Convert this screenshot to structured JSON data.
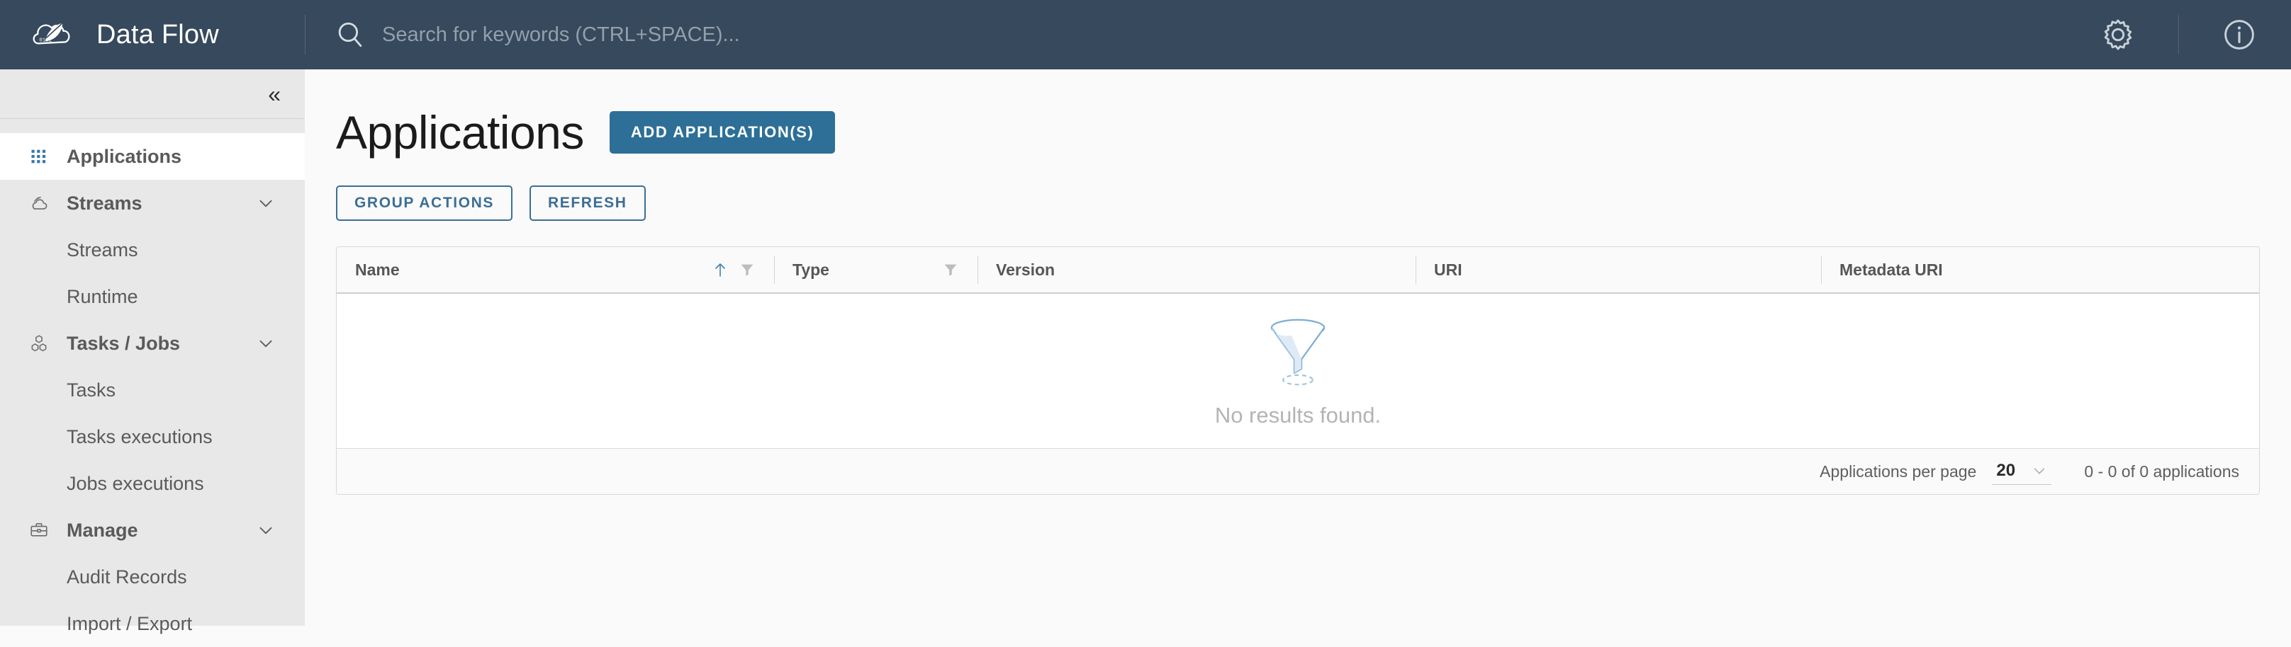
{
  "header": {
    "brand_title": "Data Flow",
    "logo_icon": "spring-cloud-dataflow-logo",
    "search": {
      "icon": "search-icon",
      "placeholder": "Search for keywords (CTRL+SPACE)...",
      "value": ""
    },
    "settings_icon": "gear-icon",
    "about_icon": "info-circle-icon"
  },
  "sidebar": {
    "collapse_icon": "double-chevron-left-icon",
    "items": [
      {
        "label": "Applications",
        "icon": "grid-dots-icon",
        "type": "link",
        "active": true,
        "expandable": false
      },
      {
        "label": "Streams",
        "icon": "cloud-icon",
        "type": "group",
        "active": false,
        "expandable": true
      },
      {
        "label": "Streams",
        "icon": "",
        "type": "sub",
        "active": false,
        "expandable": false
      },
      {
        "label": "Runtime",
        "icon": "",
        "type": "sub",
        "active": false,
        "expandable": false
      },
      {
        "label": "Tasks / Jobs",
        "icon": "boxes-icon",
        "type": "group",
        "active": false,
        "expandable": true
      },
      {
        "label": "Tasks",
        "icon": "",
        "type": "sub",
        "active": false,
        "expandable": false
      },
      {
        "label": "Tasks executions",
        "icon": "",
        "type": "sub",
        "active": false,
        "expandable": false
      },
      {
        "label": "Jobs executions",
        "icon": "",
        "type": "sub",
        "active": false,
        "expandable": false
      },
      {
        "label": "Manage",
        "icon": "briefcase-icon",
        "type": "group",
        "active": false,
        "expandable": true
      },
      {
        "label": "Audit Records",
        "icon": "",
        "type": "sub",
        "active": false,
        "expandable": false
      },
      {
        "label": "Import / Export",
        "icon": "",
        "type": "sub",
        "active": false,
        "expandable": false
      }
    ]
  },
  "main": {
    "title": "Applications",
    "add_button": "ADD APPLICATION(S)",
    "group_actions_button": "GROUP ACTIONS",
    "refresh_button": "REFRESH",
    "table": {
      "columns": [
        {
          "label": "Name",
          "sortable": true,
          "sort": "asc",
          "filter": true
        },
        {
          "label": "Type",
          "sortable": false,
          "sort": "none",
          "filter": true
        },
        {
          "label": "Version",
          "sortable": false,
          "sort": "none",
          "filter": false
        },
        {
          "label": "URI",
          "sortable": false,
          "sort": "none",
          "filter": false
        },
        {
          "label": "Metadata URI",
          "sortable": false,
          "sort": "none",
          "filter": false
        }
      ],
      "rows": [],
      "empty_text": "No results found.",
      "empty_icon": "funnel-icon"
    },
    "pagination": {
      "per_page_label": "Applications per page",
      "per_page_value": "20",
      "per_page_chevron": "chevron-down-icon",
      "range_text": "0 - 0 of 0 applications"
    }
  },
  "colors": {
    "topbar_bg": "#36495d",
    "sidebar_bg": "#e8e8e8",
    "accent_blue": "#2d6f96",
    "outline_blue": "#3b6e95",
    "active_icon_blue": "#3778a8",
    "funnel_blue": "#8cb7d6"
  }
}
